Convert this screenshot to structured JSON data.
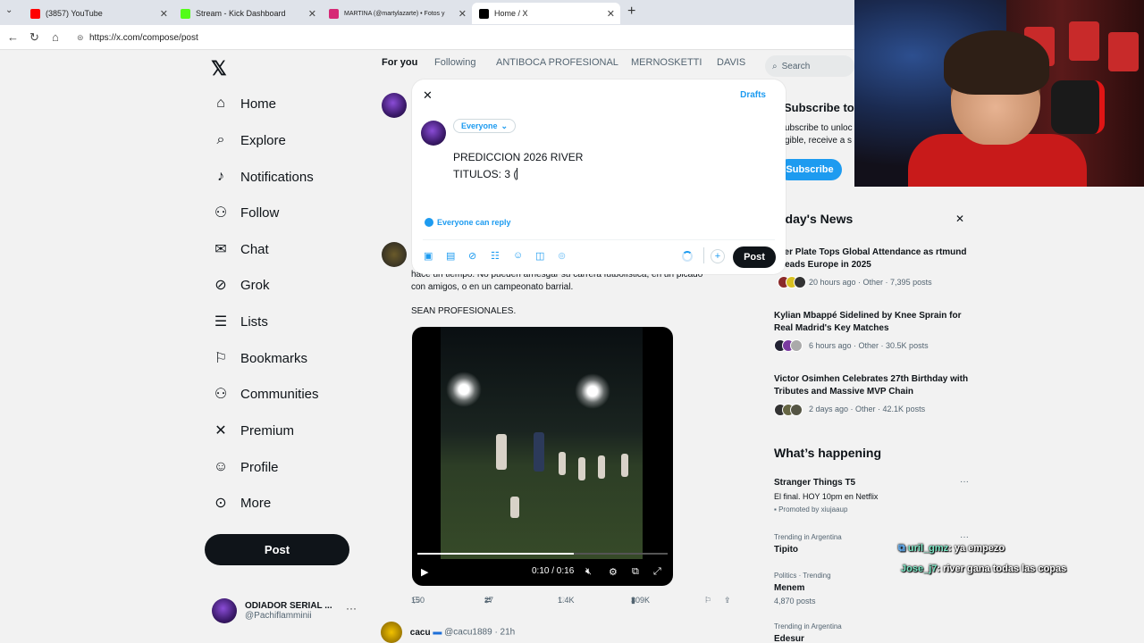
{
  "browser": {
    "tabs": [
      {
        "title": "(3857) YouTube",
        "color": "#ff0000"
      },
      {
        "title": "Stream - Kick Dashboard",
        "color": "#53fc18"
      },
      {
        "title": "MARTINA (@martylazarte) • Fotos y",
        "color": "#d62976"
      },
      {
        "title": "Home / X",
        "color": "#000000"
      }
    ],
    "url": "https://x.com/compose/post"
  },
  "sidebar": {
    "items": [
      {
        "label": "Home",
        "icon": "home-icon"
      },
      {
        "label": "Explore",
        "icon": "search-icon"
      },
      {
        "label": "Notifications",
        "icon": "bell-icon"
      },
      {
        "label": "Follow",
        "icon": "follow-icon"
      },
      {
        "label": "Chat",
        "icon": "mail-icon"
      },
      {
        "label": "Grok",
        "icon": "grok-icon"
      },
      {
        "label": "Lists",
        "icon": "list-icon"
      },
      {
        "label": "Bookmarks",
        "icon": "bookmark-icon"
      },
      {
        "label": "Communities",
        "icon": "communities-icon"
      },
      {
        "label": "Premium",
        "icon": "x-icon"
      },
      {
        "label": "Profile",
        "icon": "profile-icon"
      },
      {
        "label": "More",
        "icon": "more-icon"
      }
    ],
    "post_label": "Post",
    "account": {
      "name": "ODIADOR SERIAL ...",
      "handle": "@Pachiflamminii"
    }
  },
  "top_tabs": [
    "For you",
    "Following",
    "ANTIBOCA PROFESIONAL",
    "MERNOSKETTI",
    "DAVIS"
  ],
  "search_placeholder": "Search",
  "timeline": {
    "tweet_line1": "hace un tiempo. No pueden arriesgar su carrera futbolística, en un picado",
    "tweet_line2": "con amigos, o en un campeonato barrial.",
    "tweet_line3": "SEAN PROFESIONALES.",
    "video_time": "0:10 / 0:16",
    "video_progress": 0.625,
    "actions": {
      "replies": "150",
      "reposts": "27",
      "likes": "1.4K",
      "views": "309K"
    },
    "next_user": "cacu",
    "next_handle": "@cacu1889 · 21h"
  },
  "right": {
    "subscribe_title": "Subscribe to",
    "subscribe_text1": "ubscribe to unloc",
    "subscribe_text2": "gible, receive a s",
    "subscribe_btn": "Subscribe",
    "news_title": "oday's News",
    "news": [
      {
        "title": "ver Plate Tops Global Attendance as rtmund Leads Europe in 2025",
        "meta": "20 hours ago · Other · 7,395 posts"
      },
      {
        "title": "Kylian Mbappé Sidelined by Knee Sprain for Real Madrid's Key Matches",
        "meta": "6 hours ago · Other · 30.5K posts"
      },
      {
        "title": "Victor Osimhen Celebrates 27th Birthday with Tributes and Massive MVP Chain",
        "meta": "2 days ago · Other · 42.1K posts"
      }
    ],
    "happening_title": "What’s happening",
    "trends": [
      {
        "small": "",
        "name": "Stranger Things T5",
        "sub": "El final. HOY 10pm en Netflix",
        "promo": "Promoted by xiujaaup"
      },
      {
        "small": "Trending in Argentina",
        "name": "Tipito",
        "sub": ""
      },
      {
        "small": "Politics · Trending",
        "name": "Menem",
        "sub": "4,870 posts"
      },
      {
        "small": "Trending in Argentina",
        "name": "Edesur",
        "sub": ""
      }
    ]
  },
  "compose": {
    "drafts": "Drafts",
    "audience": "Everyone",
    "text_line1": "PREDICCION 2026 RIVER",
    "text_line2": "TITULOS: 3 (",
    "reply_setting": "Everyone can reply",
    "post_label": "Post"
  },
  "chat": [
    {
      "user": "uril_gmz",
      "msg": ": ya empezo"
    },
    {
      "user": "Jose_j7",
      "msg": ": river gana todas las copas"
    }
  ],
  "colors": {
    "accent": "#1d9bf0",
    "dark": "#0f1419",
    "chat_user": "#7de8c6"
  }
}
